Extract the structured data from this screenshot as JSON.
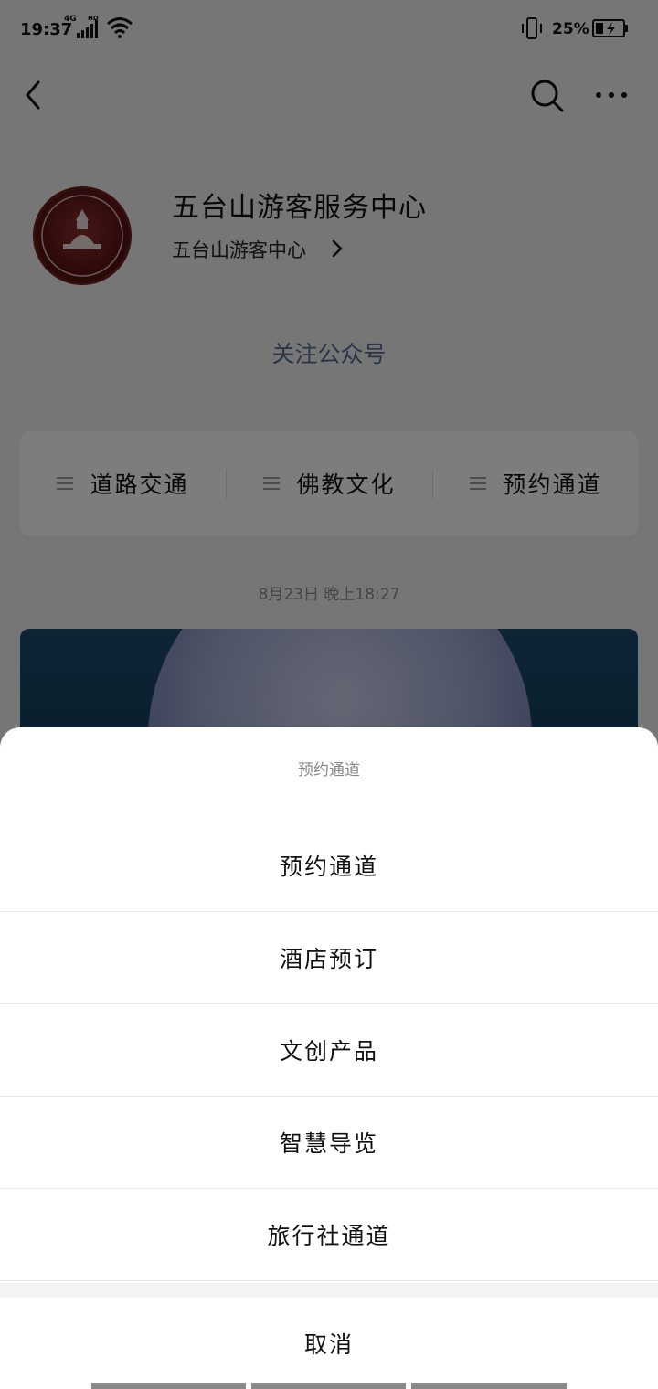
{
  "status_bar": {
    "time": "19:37",
    "network": "4G",
    "hd": "HD",
    "battery_percent": "25%",
    "battery_level": 0.25
  },
  "nav": {
    "back_icon": "chevron-left-icon",
    "search_icon": "search-icon",
    "more_icon": "more-icon"
  },
  "profile": {
    "title": "五台山游客服务中心",
    "subtitle": "五台山游客中心",
    "follow": "关注公众号"
  },
  "menu": {
    "items": [
      {
        "label": "道路交通"
      },
      {
        "label": "佛教文化"
      },
      {
        "label": "预约通道"
      }
    ]
  },
  "feed": {
    "date": "8月23日 晚上18:27"
  },
  "sheet": {
    "title": "预约通道",
    "options": [
      {
        "label": "预约通道"
      },
      {
        "label": "酒店预订"
      },
      {
        "label": "文创产品"
      },
      {
        "label": "智慧导览"
      },
      {
        "label": "旅行社通道"
      }
    ],
    "cancel": "取消"
  },
  "colors": {
    "link": "#576b95",
    "background": "#ededed",
    "overlay": "rgba(0,0,0,0.5)"
  }
}
